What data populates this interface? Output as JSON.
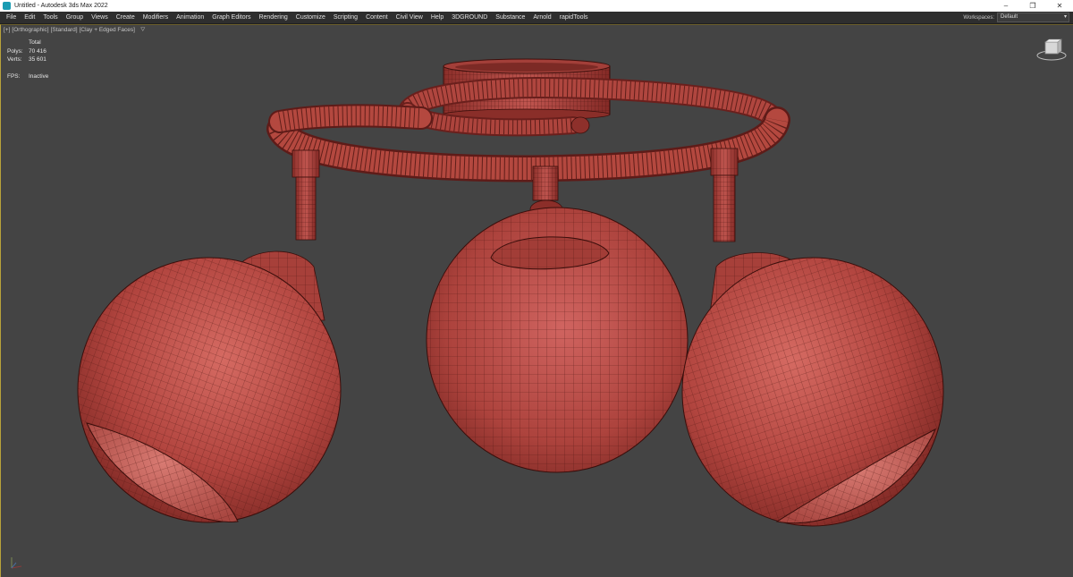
{
  "window": {
    "title": "Untitled - Autodesk 3ds Max 2022",
    "controls": {
      "minimize": "–",
      "maximize": "❐",
      "close": "✕"
    }
  },
  "menu": {
    "items": [
      "File",
      "Edit",
      "Tools",
      "Group",
      "Views",
      "Create",
      "Modifiers",
      "Animation",
      "Graph Editors",
      "Rendering",
      "Customize",
      "Scripting",
      "Content",
      "Civil View",
      "Help",
      "3DGROUND",
      "Substance",
      "Arnold",
      "rapidTools"
    ],
    "workspace_label": "Workspaces:",
    "workspace_value": "Default"
  },
  "viewport": {
    "labels": [
      "[+]",
      "[Orthographic]",
      "[Standard]",
      "[Clay + Edged Faces]"
    ],
    "stats": {
      "header": "Total",
      "polys_label": "Polys:",
      "polys_value": "70 416",
      "verts_label": "Verts:",
      "verts_value": "35 601",
      "fps_label": "FPS:",
      "fps_value": "Inactive"
    }
  },
  "colors": {
    "clay": "#b84a44",
    "clay_dark": "#6a1f1c",
    "wire": "#4a1410",
    "viewport_bg": "#444444",
    "menu_bg": "#2e2e2e",
    "active_border": "#b9a23a"
  },
  "icons": {
    "app": "3ds-max-app-icon",
    "viewcube": "viewcube-icon",
    "filter": "filter-icon",
    "axis": "axis-tripod-icon"
  }
}
